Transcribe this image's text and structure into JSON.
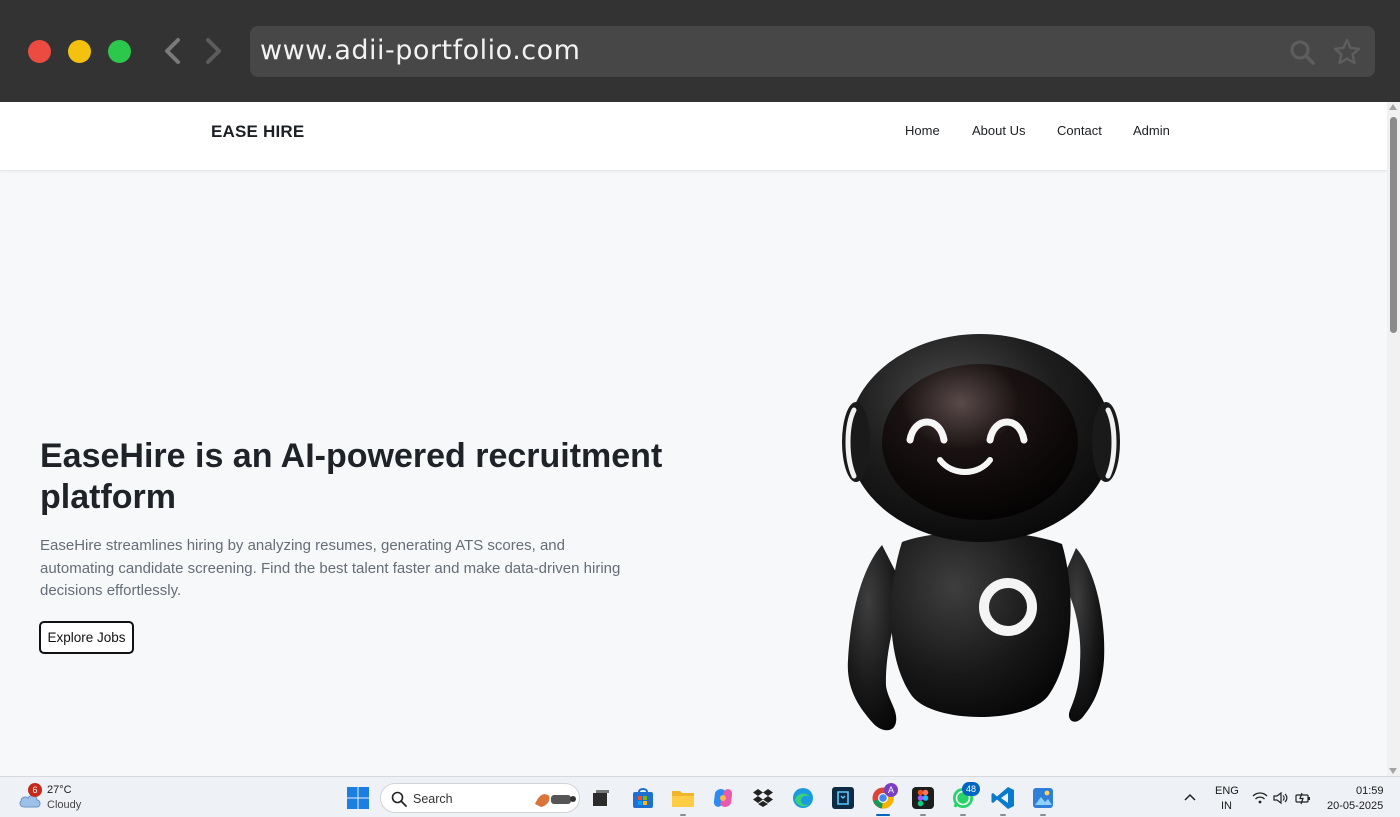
{
  "browser": {
    "url": "www.adii-portfolio.com"
  },
  "site": {
    "brand": "EASE HIRE",
    "nav": [
      {
        "label": "Home"
      },
      {
        "label": "About Us"
      },
      {
        "label": "Contact"
      },
      {
        "label": "Admin"
      }
    ],
    "hero": {
      "title": "EaseHire is an AI-powered recruitment platform",
      "description": "EaseHire streamlines hiring by analyzing resumes, generating ATS scores, and automating candidate screening. Find the best talent faster and make data-driven hiring decisions effortlessly.",
      "cta_label": "Explore Jobs"
    }
  },
  "taskbar": {
    "weather": {
      "badge": "6",
      "temp": "27°C",
      "condition": "Cloudy"
    },
    "search_label": "Search",
    "whatsapp_badge": "48",
    "chrome_profile_badge": "A",
    "tray": {
      "lang_line1": "ENG",
      "lang_line2": "IN",
      "time": "01:59",
      "date": "20-05-2025"
    }
  },
  "colors": {
    "chrome_bg": "#333333",
    "page_bg": "#f7f8fa",
    "text_dark": "#1f2328",
    "text_muted": "#656d76",
    "accent_blue": "#0067c0"
  }
}
